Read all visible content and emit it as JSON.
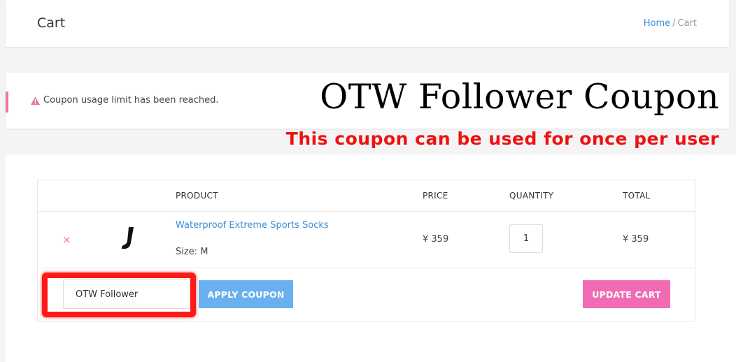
{
  "header": {
    "title": "Cart",
    "breadcrumb": {
      "home": "Home",
      "separator": "/",
      "current": "Cart"
    }
  },
  "notice": {
    "icon": "warning-icon",
    "message": "Coupon usage limit has been reached."
  },
  "overlay": {
    "title": "OTW Follower Coupon",
    "subtitle": "This coupon can be used for once per user"
  },
  "cart": {
    "columns": {
      "product": "PRODUCT",
      "price": "PRICE",
      "quantity": "QUANTITY",
      "total": "TOTAL"
    },
    "items": [
      {
        "remove_icon": "×",
        "name": "Waterproof Extreme Sports Socks",
        "size": "Size: M",
        "price": "¥ 359",
        "quantity": "1",
        "total": "¥ 359"
      }
    ],
    "coupon": {
      "value": "OTW Follower",
      "apply_label": "APPLY COUPON"
    },
    "update_label": "UPDATE CART"
  },
  "colors": {
    "link": "#3a8fd8",
    "accent_pink": "#f06bb4",
    "apply_blue": "#6aaff0",
    "highlight_red": "#ff1a1a",
    "overlay_red": "#ee1111"
  }
}
